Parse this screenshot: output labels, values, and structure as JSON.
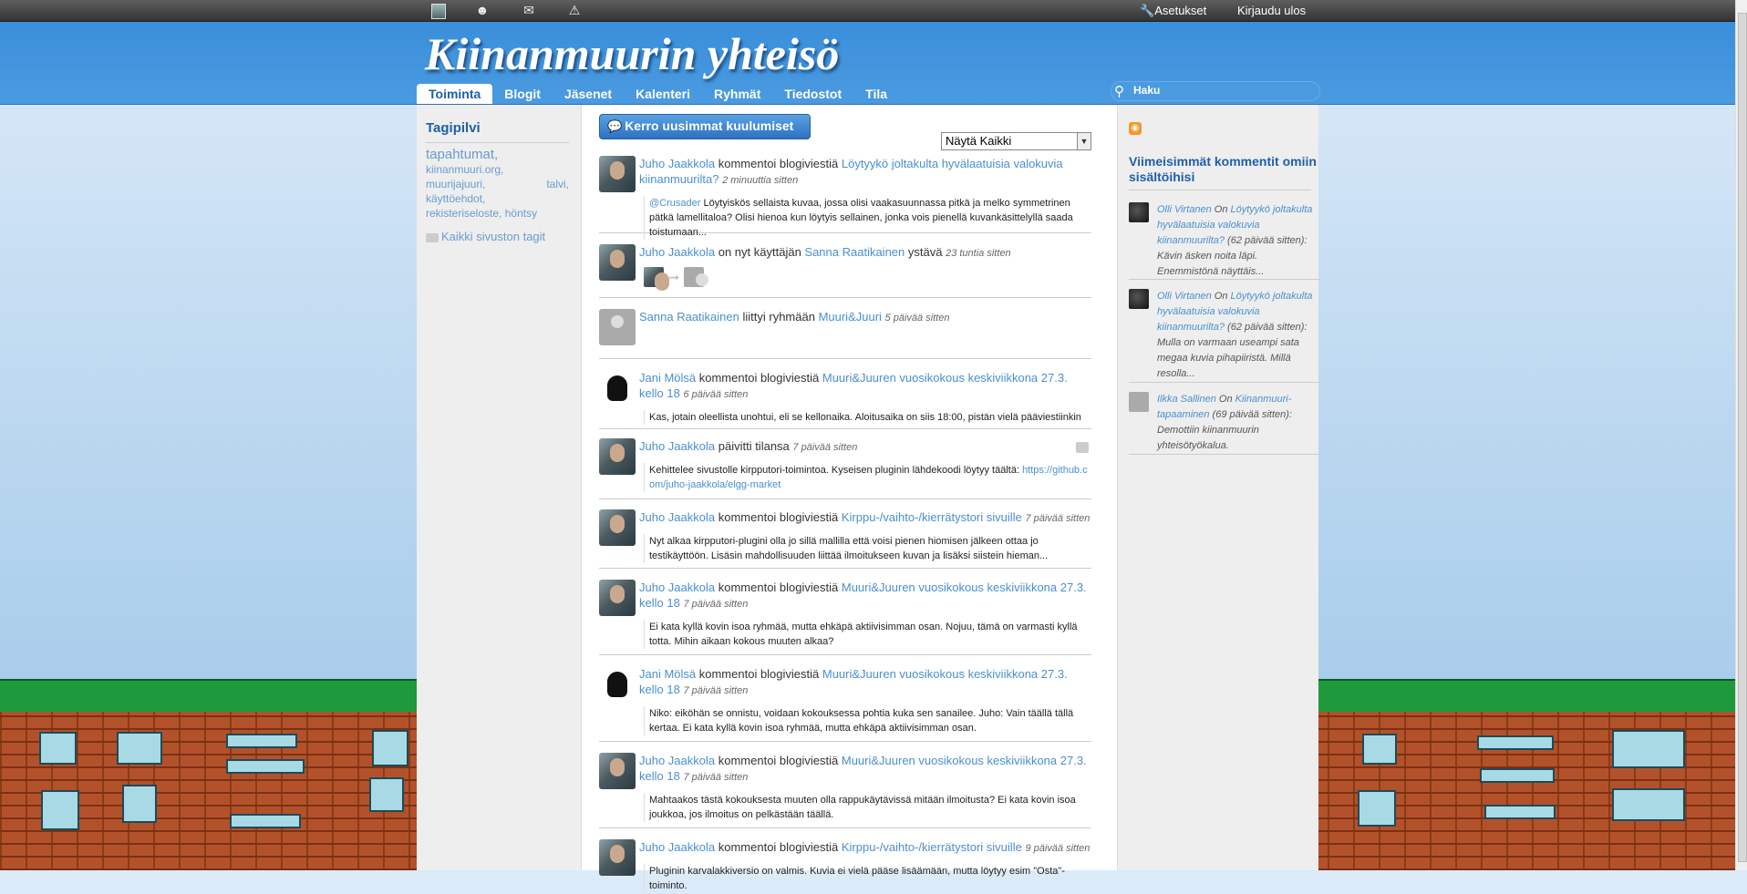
{
  "topbar": {
    "icons": [
      "avatar-icon",
      "friends-icon",
      "mail-icon",
      "warning-icon"
    ],
    "settings": "Asetukset",
    "logout": "Kirjaudu ulos"
  },
  "header": {
    "site_title": "Kiinanmuurin yhteisö",
    "nav": [
      "Toiminta",
      "Blogit",
      "Jäsenet",
      "Kalenteri",
      "Ryhmät",
      "Tiedostot",
      "Tila"
    ],
    "search_placeholder": "Haku"
  },
  "left": {
    "title": "Tagipilvi",
    "tags": [
      "tapahtumat,",
      "kiinanmuuri.org,",
      "muurijajuuri,",
      "talvi,",
      "käyttöehdot,",
      "rekisteriseloste,",
      "höntsy"
    ],
    "all_tags": "Kaikki sivuston tagit"
  },
  "stream": {
    "share_button": "Kerro uusimmat kuulumiset",
    "filter_value": "Näytä Kaikki",
    "items": [
      {
        "user": "Juho Jaakkola",
        "action": " kommentoi blogiviestiä ",
        "target": "Löytyykö joltakulta hyvälaatuisia valokuvia kiinanmuurilta?",
        "time": "2 minuuttia sitten",
        "mention": "@Crusader",
        "content": " Löytyiskös sellaista kuvaa, jossa olisi vaakasuunnassa pitkä ja melko symmetrinen pätkä lamellitaloa? Olisi hienoa kun löytyis sellainen, jonka vois pienellä kuvankäsittelyllä saada toistumaan..."
      },
      {
        "user": "Juho Jaakkola",
        "action": " on nyt käyttäjän ",
        "target": "Sanna Raatikainen",
        "suffix": " ystävä",
        "time": "23 tuntia sitten"
      },
      {
        "user": "Sanna Raatikainen",
        "action": " liittyi ryhmään ",
        "target": "Muuri&Juuri",
        "time": "5 päivää sitten"
      },
      {
        "user": "Jani Mölsä",
        "action": " kommentoi blogiviestiä ",
        "target": "Muuri&Juuren vuosikokous keskiviikkona 27.3. kello 18",
        "time": "6 päivää sitten",
        "content": "Kas, jotain oleellista unohtui, eli se kellonaika. Aloitusaika on siis 18:00, pistän vielä pääviestiinkin"
      },
      {
        "user": "Juho Jaakkola",
        "action": " päivitti tilansa ",
        "time": "7 päivää sitten",
        "content": "Kehittelee sivustolle kirpputori-toimintoa. Kyseisen pluginin lähdekoodi löytyy täältä: ",
        "link": "https://github.com/juho-jaakkola/elgg-market"
      },
      {
        "user": "Juho Jaakkola",
        "action": " kommentoi blogiviestiä ",
        "target": "Kirppu-/vaihto-/kierrätystori sivuille",
        "time": "7 päivää sitten",
        "content": "Nyt alkaa kirpputori-plugini olla jo sillä mallilla että voisi pienen hiomisen jälkeen ottaa jo testikäyttöön. Lisäsin mahdollisuuden liittää ilmoitukseen kuvan ja lisäksi siistein hieman..."
      },
      {
        "user": "Juho Jaakkola",
        "action": " kommentoi blogiviestiä ",
        "target": "Muuri&Juuren vuosikokous keskiviikkona 27.3. kello 18",
        "time": "7 päivää sitten",
        "content": "Ei kata kyllä kovin isoa ryhmää, mutta ehkäpä aktiivisimman osan. Nojuu, tämä on varmasti kyllä totta. Mihin aikaan kokous muuten alkaa?"
      },
      {
        "user": "Jani Mölsä",
        "action": " kommentoi blogiviestiä ",
        "target": "Muuri&Juuren vuosikokous keskiviikkona 27.3. kello 18",
        "time": "7 päivää sitten",
        "content": "Niko: eiköhän se onnistu, voidaan kokouksessa pohtia kuka sen sanailee.   Juho: Vain täällä tällä kertaa. Ei kata kyllä kovin isoa ryhmää, mutta ehkäpä aktiivisimman osan."
      },
      {
        "user": "Juho Jaakkola",
        "action": " kommentoi blogiviestiä ",
        "target": "Muuri&Juuren vuosikokous keskiviikkona 27.3. kello 18",
        "time": "7 päivää sitten",
        "content": "Mahtaakos tästä kokouksesta muuten olla rappukäytävissä mitään ilmoitusta? Ei kata kovin isoa joukkoa, jos ilmoitus on pelkästään täällä."
      },
      {
        "user": "Juho Jaakkola",
        "action": " kommentoi blogiviestiä ",
        "target": "Kirppu-/vaihto-/kierrätystori sivuille",
        "time": "9 päivää sitten",
        "content": "Pluginin karvalakkiversio on valmis. Kuvia ei vielä pääse lisäämään, mutta löytyy esim \"Osta\"-toiminto."
      }
    ]
  },
  "right": {
    "title": "Viimeisimmät kommentit omiin sisältöihisi",
    "comments": [
      {
        "user": "Olli Virtanen",
        "on": " On ",
        "target": "Löytyykö joltakulta hyvälaatuisia valokuvia kiinanmuurilta?",
        "meta": " (62 päivää sitten): ",
        "text": "Kävin äsken noita läpi. Enemmistönä näyttäis..."
      },
      {
        "user": "Olli Virtanen",
        "on": " On ",
        "target": "Löytyykö joltakulta hyvälaatuisia valokuvia kiinanmuurilta?",
        "meta": " (62 päivää sitten): ",
        "text": "Mulla on varmaan useampi sata megaa kuvia pihapiiristä. Millä resolla..."
      },
      {
        "user": "Ilkka Sallinen",
        "on": " On ",
        "target": "Kiinanmuuri-tapaaminen",
        "meta": " (69 päivää sitten): ",
        "text": "Demottiin kiinanmuurin yhteisötyökalua."
      }
    ]
  }
}
